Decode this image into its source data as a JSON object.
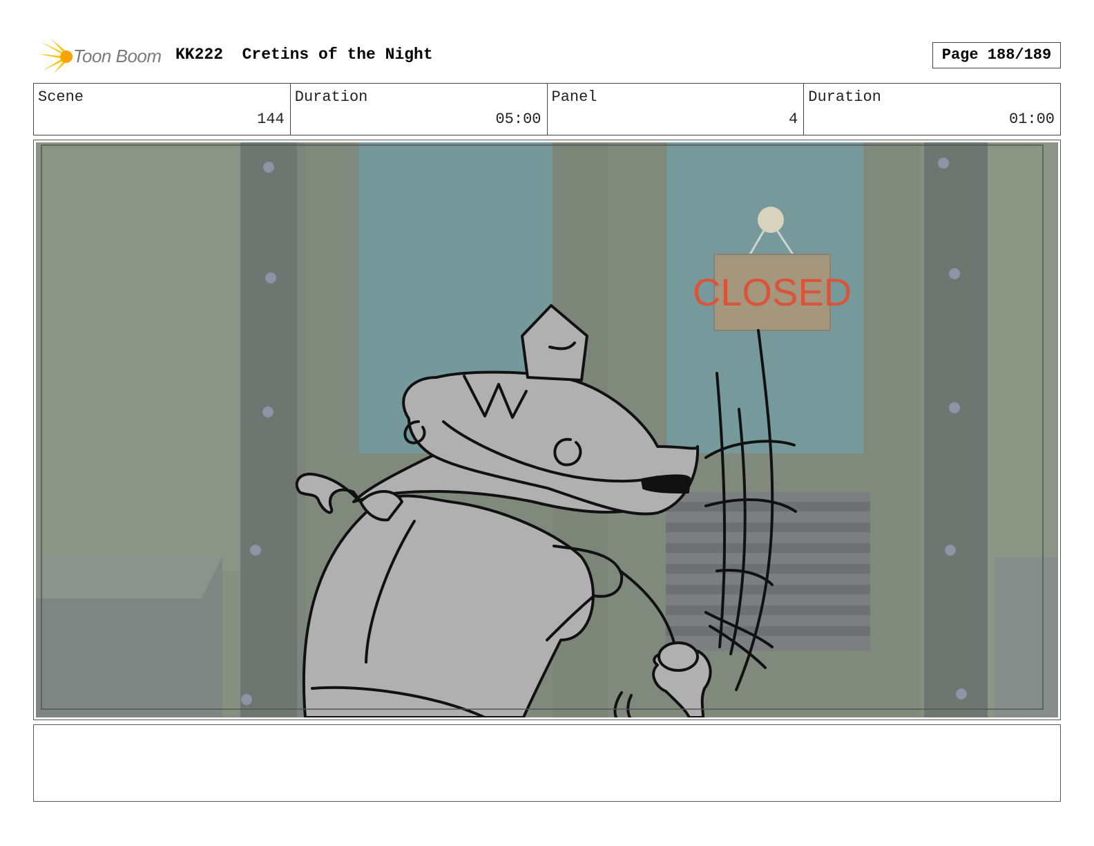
{
  "header": {
    "logo_text": "Toon Boom",
    "title": "KK222  Cretins of the Night",
    "page": "Page 188/189"
  },
  "info": {
    "scene_label": "Scene",
    "scene_value": "144",
    "duration_label": "Duration",
    "duration_value": "05:00",
    "panel_label": "Panel",
    "panel_value": "4",
    "panel_duration_label": "Duration",
    "panel_duration_value": "01:00"
  },
  "panel": {
    "sign_text": "CLOSED"
  },
  "notes": {
    "text": ""
  }
}
